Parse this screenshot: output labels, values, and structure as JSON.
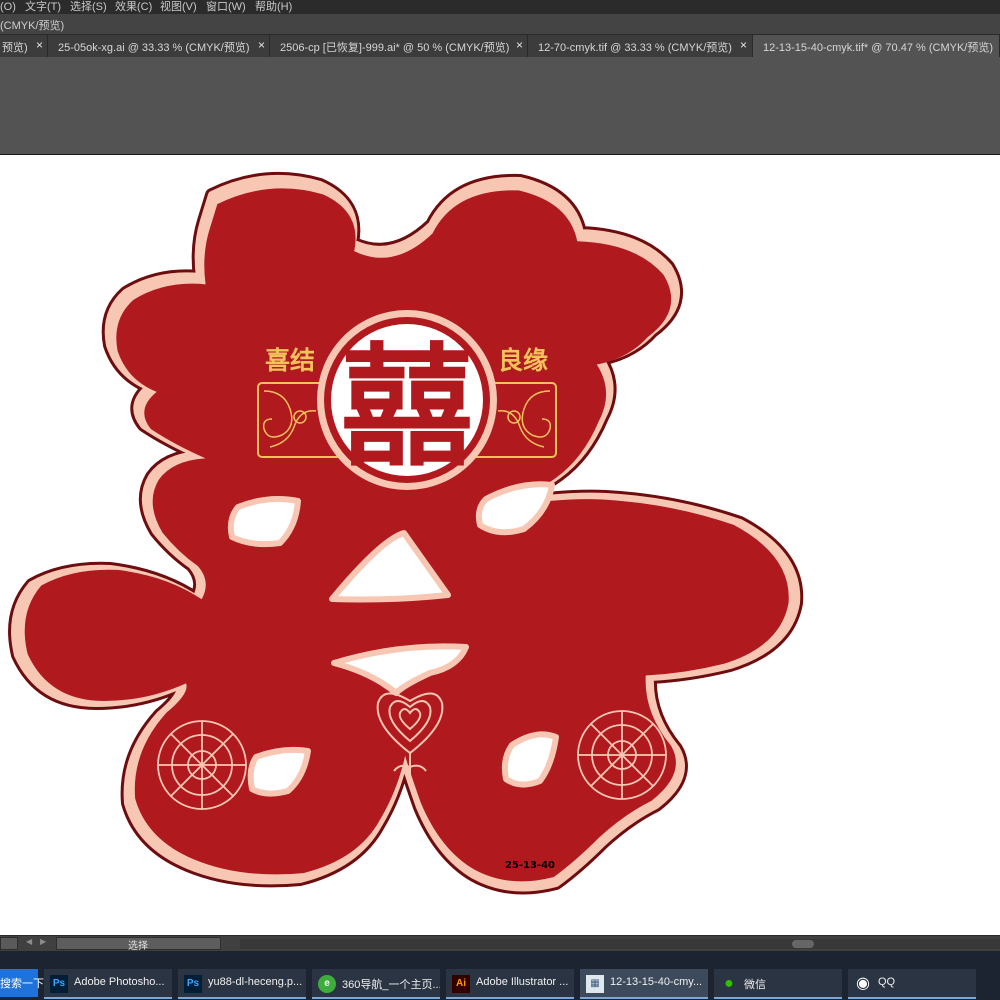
{
  "menubar": {
    "items": [
      "(O)",
      "文字(T)",
      "选择(S)",
      "效果(C)",
      "视图(V)",
      "窗口(W)",
      "帮助(H)"
    ]
  },
  "window": {
    "title_fragment": "(CMYK/预览)"
  },
  "tabs": [
    {
      "label": "预览)",
      "close": "×"
    },
    {
      "label": "25-05ok-xg.ai @ 33.33 % (CMYK/预览)",
      "close": "×"
    },
    {
      "label": "2506-cp [已恢复]-999.ai* @ 50 % (CMYK/预览)",
      "close": "×"
    },
    {
      "label": "12-70-cmyk.tif @ 33.33 % (CMYK/预览)",
      "close": "×"
    },
    {
      "label": "12-13-15-40-cmyk.tif* @ 70.47 % (CMYK/预览)",
      "close": "×",
      "active": true
    }
  ],
  "artwork": {
    "banner_left": "喜结",
    "banner_right": "良缘",
    "medallion_glyph": "囍",
    "code_label": "25-13-40",
    "colors": {
      "red": "#b0191e",
      "dark_outline": "#6e0d0f",
      "light_outline": "#f7c7b4",
      "gold": "#f3c25c"
    }
  },
  "statusbar": {
    "status_text": "选择",
    "nav_prev": "◀",
    "nav_next": "▶"
  },
  "taskbar": {
    "search_label": "搜索一下",
    "items": [
      {
        "icon": "photoshop-icon",
        "icon_text": "Ps",
        "label": "Adobe Photosho..."
      },
      {
        "icon": "photoshop-file-icon",
        "icon_text": "Ps",
        "label": "yu88-dl-heceng.p..."
      },
      {
        "icon": "browser-360-icon",
        "icon_text": "e",
        "label": "360导航_一个主页..."
      },
      {
        "icon": "illustrator-icon",
        "icon_text": "Ai",
        "label": "Adobe Illustrator ..."
      },
      {
        "icon": "image-file-icon",
        "icon_text": "▦",
        "label": "12-13-15-40-cmy...",
        "active": true
      },
      {
        "icon": "wechat-icon",
        "icon_text": "●",
        "label": "微信"
      },
      {
        "icon": "qq-icon",
        "icon_text": "◉",
        "label": "QQ"
      }
    ]
  }
}
